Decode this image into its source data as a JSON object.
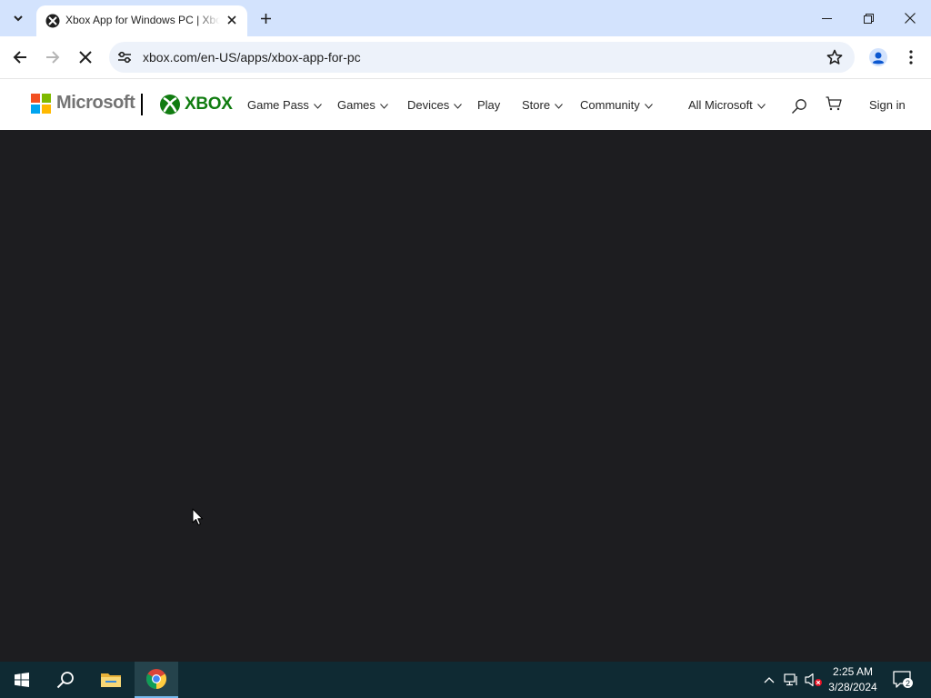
{
  "browser": {
    "tab": {
      "title": "Xbox App for Windows PC | Xbox",
      "close_icon": "close-icon",
      "favicon": "xbox-favicon"
    },
    "new_tab_icon": "plus-icon",
    "address_bar": {
      "url": "xbox.com/en-US/apps/xbox-app-for-pc"
    },
    "loading": true
  },
  "header": {
    "microsoft_logo_text": "Microsoft",
    "xbox_logo_text": "XBOX",
    "nav": [
      {
        "label": "Game Pass",
        "has_dropdown": true
      },
      {
        "label": "Games",
        "has_dropdown": true
      },
      {
        "label": "Devices",
        "has_dropdown": true
      },
      {
        "label": "Play",
        "has_dropdown": false
      },
      {
        "label": "Store",
        "has_dropdown": true
      },
      {
        "label": "Community",
        "has_dropdown": true
      }
    ],
    "all_microsoft": "All Microsoft",
    "sign_in": "Sign in"
  },
  "taskbar": {
    "time": "2:25 AM",
    "date": "3/28/2024",
    "notification_count": "2"
  },
  "colors": {
    "tabstrip": "#d3e3fd",
    "content_bg": "#1d1d20",
    "xbox_green": "#107c10",
    "taskbar": "#0f2a33"
  }
}
